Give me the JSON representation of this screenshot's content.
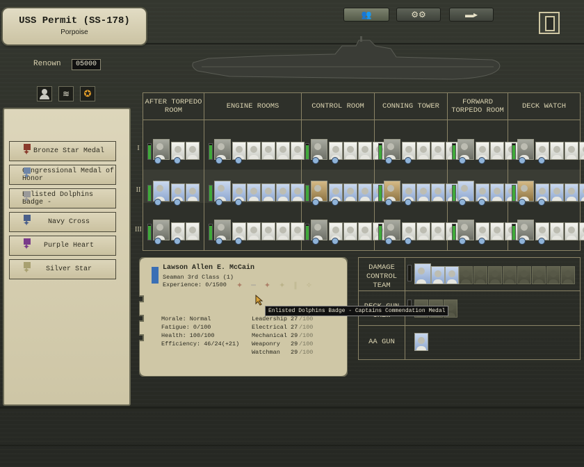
{
  "submarine": {
    "name": "USS Permit (SS-178)",
    "class": "Porpoise"
  },
  "renown": {
    "label": "Renown",
    "value": "05000"
  },
  "tabs": [
    "crew-icon",
    "gears-icon",
    "torpedo-icon"
  ],
  "exit_icon": "door-icon",
  "filter_icons": [
    "officer-icon",
    "rank-chevrons-icon",
    "medal-icon"
  ],
  "compartments": [
    "AFTER TORPEDO ROOM",
    "ENGINE ROOMS",
    "CONTROL ROOM",
    "CONNING TOWER",
    "FORWARD TORPEDO ROOM",
    "DECK WATCH"
  ],
  "watches": [
    "I",
    "II",
    "III"
  ],
  "medals": [
    {
      "label": "Bronze Star Medal",
      "color": "#8a3b2c"
    },
    {
      "label": "Congressional Medal of Honor",
      "color": "#6f86a8"
    },
    {
      "label": "Enlisted Dolphins Badge -",
      "color": "#9a9a9a"
    },
    {
      "label": "Navy Cross",
      "color": "#4a5f8a"
    },
    {
      "label": "Purple Heart",
      "color": "#7a3b8a"
    },
    {
      "label": "Silver Star",
      "color": "#a8a070"
    }
  ],
  "crew_member": {
    "name": "Lawson Allen E. McCain",
    "rank": "Seaman 3rd Class (1)",
    "experience": "Experience: 0/1500",
    "stats": [
      {
        "label": "Morale: Normal"
      },
      {
        "label": "Fatigue: 0/100"
      },
      {
        "label": "Health: 100/100"
      },
      {
        "label": "Efficiency: 46/24(+21)"
      }
    ],
    "skills": [
      {
        "label": "Leadership",
        "value": "27",
        "max": "/100"
      },
      {
        "label": "Electrical",
        "value": "27",
        "max": "/100"
      },
      {
        "label": "Mechanical",
        "value": "29",
        "max": "/100"
      },
      {
        "label": "Weaponry",
        "value": "29",
        "max": "/100"
      },
      {
        "label": "Watchman",
        "value": "29",
        "max": "/100"
      }
    ]
  },
  "tooltip": "Enlisted Dolphins Badge - Captains Commendation Medal",
  "special_stations": [
    {
      "label": "DAMAGE CONTROL TEAM"
    },
    {
      "label": "DECK GUN CREW"
    },
    {
      "label": "AA GUN"
    }
  ]
}
